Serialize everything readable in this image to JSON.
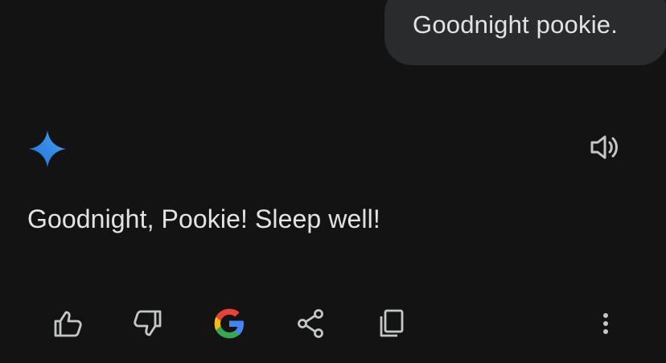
{
  "conversation": {
    "user_message": "Goodnight pookie.",
    "assistant_response": "Goodnight, Pookie! Sleep well!"
  },
  "icons": {
    "assistant_logo": "gemini-sparkle-icon",
    "speaker": "volume-up-icon",
    "thumbs_up": "thumbs-up-icon",
    "thumbs_down": "thumbs-down-icon",
    "google": "google-g-icon",
    "share": "share-icon",
    "copy": "copy-icon",
    "more": "more-vert-icon"
  },
  "colors": {
    "background": "#131314",
    "bubble": "#2a2b2d",
    "text": "#e3e3e3",
    "icon": "#c4c7c5",
    "gemini_gradient": [
      "#4796e3",
      "#1e6fd9"
    ],
    "google_blue": "#4285f4",
    "google_red": "#ea4335",
    "google_yellow": "#fbbc05",
    "google_green": "#34a853"
  }
}
